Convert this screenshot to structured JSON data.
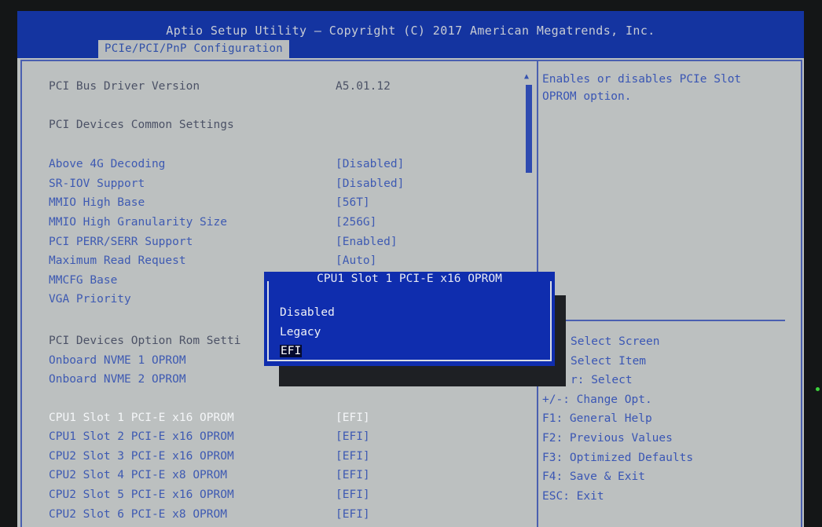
{
  "title": "Aptio Setup Utility – Copyright (C) 2017 American Megatrends, Inc.",
  "tab": "PCIe/PCI/PnP Configuration",
  "info_rows": [
    {
      "label": "PCI Bus Driver Version",
      "value": "A5.01.12"
    },
    {
      "label": "PCI Devices Common Settings",
      "value": ""
    }
  ],
  "settings": [
    {
      "label": "Above 4G Decoding",
      "value": "[Disabled]"
    },
    {
      "label": "SR-IOV Support",
      "value": "[Disabled]"
    },
    {
      "label": "MMIO High Base",
      "value": "[56T]"
    },
    {
      "label": "MMIO High Granularity Size",
      "value": "[256G]"
    },
    {
      "label": "PCI PERR/SERR Support",
      "value": "[Enabled]"
    },
    {
      "label": "Maximum Read Request",
      "value": "[Auto]"
    },
    {
      "label": "MMCFG Base",
      "value": ""
    },
    {
      "label": "VGA Priority",
      "value": ""
    }
  ],
  "option_rom_heading": "PCI Devices Option Rom Setti",
  "nvme_rows": [
    {
      "label": "Onboard NVME 1 OPROM",
      "value": ""
    },
    {
      "label": "Onboard NVME 2 OPROM",
      "value": ""
    }
  ],
  "slot_rows": [
    {
      "label": "CPU1 Slot 1 PCI-E x16 OPROM",
      "value": "[EFI]",
      "selected": true
    },
    {
      "label": "CPU1 Slot 2 PCI-E x16 OPROM",
      "value": "[EFI]"
    },
    {
      "label": "CPU2 Slot 3 PCI-E x16 OPROM",
      "value": "[EFI]"
    },
    {
      "label": "CPU2 Slot 4 PCI-E x8 OPROM",
      "value": "[EFI]"
    },
    {
      "label": "CPU2 Slot 5 PCI-E x16 OPROM",
      "value": "[EFI]"
    },
    {
      "label": "CPU2 Slot 6 PCI-E x8 OPROM",
      "value": "[EFI]"
    }
  ],
  "help": {
    "line1": "Enables or disables PCIe Slot",
    "line2": "OPROM option."
  },
  "popup": {
    "title": "CPU1 Slot 1 PCI-E x16 OPROM",
    "options": [
      "Disabled",
      "Legacy",
      "EFI"
    ],
    "selected_index": 2
  },
  "keys": [
    "Select Screen",
    "Select Item",
    "r: Select",
    "+/-: Change Opt.",
    "F1: General Help",
    "F2: Previous Values",
    "F3: Optimized Defaults",
    "F4: Save & Exit",
    "ESC: Exit"
  ],
  "colors": {
    "title_bar": "#1434a0",
    "screen_bg": "#bcc0c0",
    "text_blue": "#3e5ab2",
    "popup_bg": "#0f2dae",
    "selected_text": "#f4f6f8"
  }
}
